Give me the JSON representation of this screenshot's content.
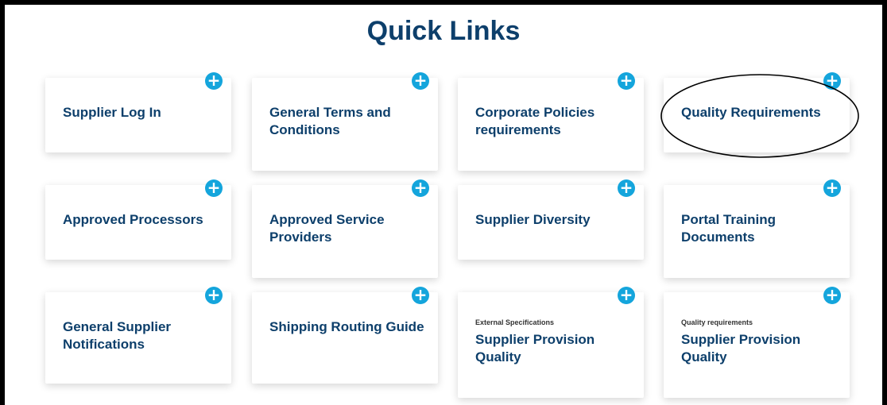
{
  "page": {
    "title": "Quick Links"
  },
  "cards": [
    {
      "label": "Supplier Log In",
      "sub": ""
    },
    {
      "label": "General Terms and Conditions",
      "sub": ""
    },
    {
      "label": "Corporate Policies requirements",
      "sub": ""
    },
    {
      "label": "Quality Requirements",
      "sub": ""
    },
    {
      "label": "Approved Processors",
      "sub": ""
    },
    {
      "label": "Approved Service Providers",
      "sub": ""
    },
    {
      "label": "Supplier Diversity",
      "sub": ""
    },
    {
      "label": "Portal Training Documents",
      "sub": ""
    },
    {
      "label": "General Supplier Notifications",
      "sub": ""
    },
    {
      "label": "Shipping Routing Guide",
      "sub": ""
    },
    {
      "label": "Supplier Provision Quality",
      "sub": "External Specifications"
    },
    {
      "label": "Supplier Provision Quality",
      "sub": "Quality requirements"
    }
  ],
  "icons": {
    "expand": "plus-circle-icon",
    "plus_glyph": "+"
  },
  "colors": {
    "accent": "#14a5dc",
    "heading": "#0d3f6b"
  }
}
